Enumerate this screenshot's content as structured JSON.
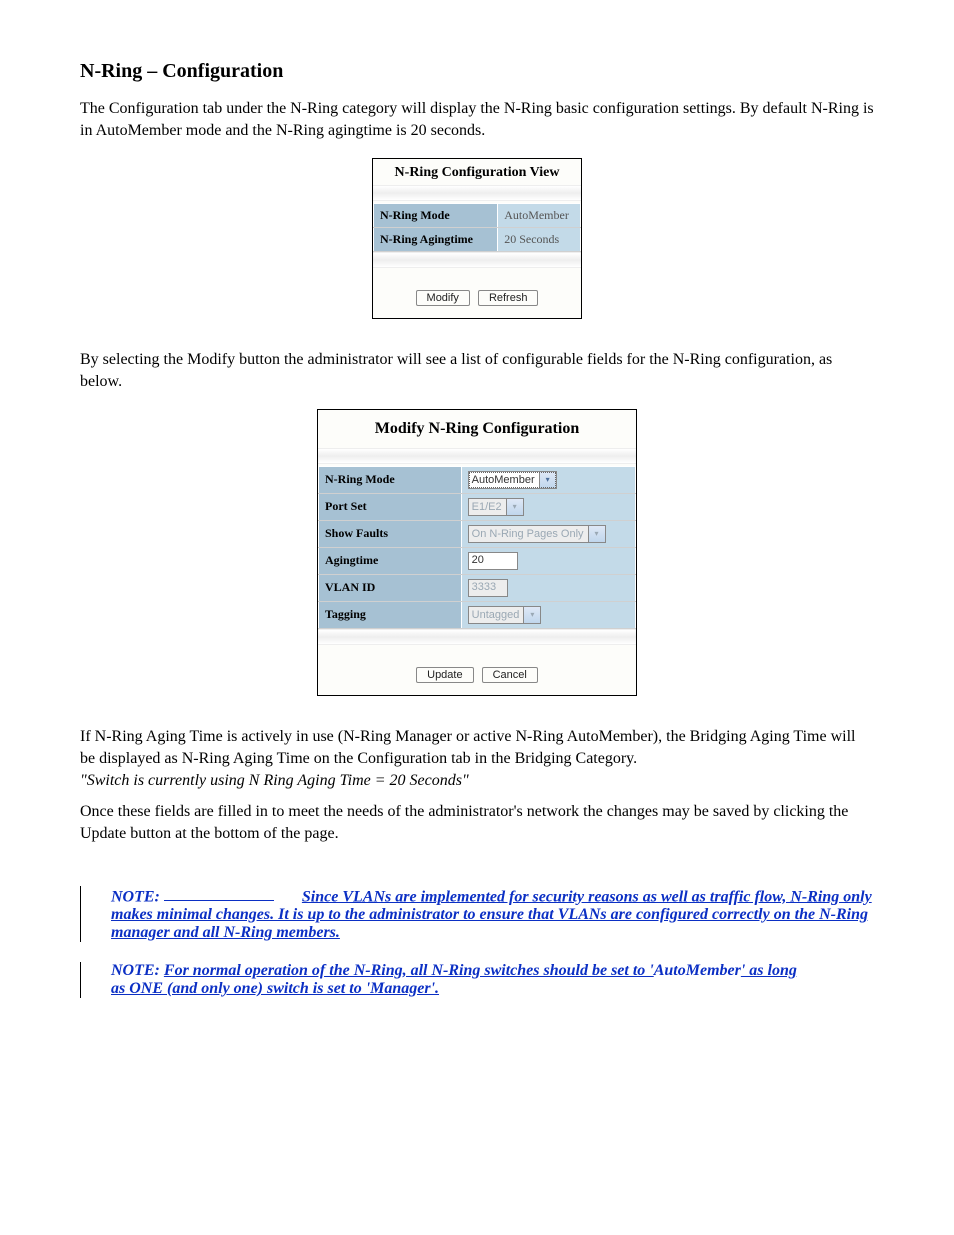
{
  "heading": "N-Ring – Configuration",
  "intro": "The Configuration tab under the N-Ring category will display the N-Ring basic configuration settings. By default N-Ring is in AutoMember mode and the N-Ring agingtime is 20 seconds.",
  "panel1": {
    "title": "N-Ring Configuration View",
    "rows": [
      {
        "label": "N-Ring Mode",
        "value": "AutoMember"
      },
      {
        "label": "N-Ring Agingtime",
        "value": "20 Seconds"
      }
    ],
    "buttons": {
      "modify": "Modify",
      "refresh": "Refresh"
    }
  },
  "mid_text": "By selecting the Modify button the administrator will see a list of configurable fields for the N-Ring configuration, as below.",
  "panel2": {
    "title": "Modify N-Ring Configuration",
    "rows": {
      "mode": {
        "label": "N-Ring Mode",
        "value": "AutoMember",
        "type": "select",
        "disabled": false,
        "selected": true
      },
      "portset": {
        "label": "Port Set",
        "value": "E1/E2",
        "type": "select",
        "disabled": true
      },
      "faults": {
        "label": "Show Faults",
        "value": "On N-Ring Pages Only",
        "type": "select",
        "disabled": true
      },
      "aging": {
        "label": "Agingtime",
        "value": "20",
        "type": "input",
        "disabled": false,
        "width": 50
      },
      "vlan": {
        "label": "VLAN ID",
        "value": "3333",
        "type": "input",
        "disabled": true,
        "width": 40
      },
      "tagging": {
        "label": "Tagging",
        "value": "Untagged",
        "type": "select",
        "disabled": true
      }
    },
    "buttons": {
      "update": "Update",
      "cancel": "Cancel"
    }
  },
  "para3_before": "If N-Ring Aging Time is actively in use (N-Ring Manager or active N-Ring AutoMember), the Bridging Aging Time will be displayed as N-Ring Aging Time on the Configuration tab in the Bridging Category.",
  "para3_italic": "\"Switch is currently using N Ring Aging Time = 20 Seconds\"",
  "para4": "Once these fields are filled in to meet the needs of the administrator's network the changes may be saved by clicking the Update button at the bottom of the page.",
  "note1": {
    "prefix": "NOTE:",
    "text_plain": " ",
    "text_underlined": "Since VLANs are implemented for security reasons as well as traffic flow, N-Ring only makes minimal changes. It is up to the administrator to ensure that VLANs are configured correctly on the N-Ring manager and all N-Ring members."
  },
  "note2": {
    "prefix": "NOTE:",
    "line1": "For normal operation of the N-Ring, all N-Ring switches should be set to '",
    "line1_bold": "AutoMember",
    "line1_after": "' as long",
    "line2": "as ONE (and only one) switch is set to 'Manager'."
  }
}
